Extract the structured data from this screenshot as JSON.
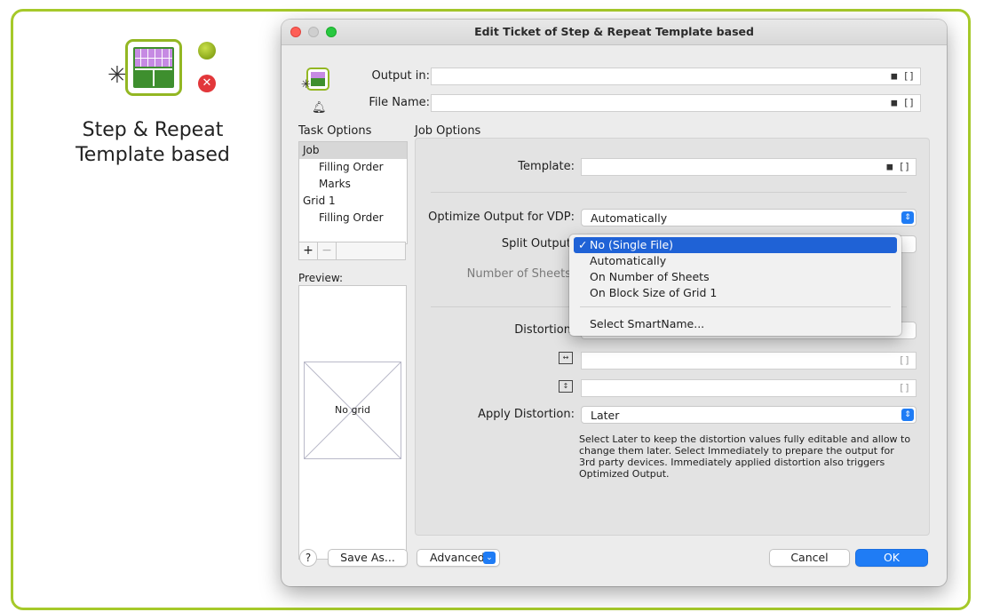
{
  "node": {
    "title_line1": "Step & Repeat",
    "title_line2": "Template based",
    "status_ok_icon": "green-status-dot",
    "status_error_icon": "red-error-x",
    "error_glyph": "✕"
  },
  "window": {
    "title": "Edit Ticket of Step & Repeat Template based"
  },
  "header": {
    "output_in_label": "Output in:",
    "output_in_value": "",
    "file_name_label": "File Name:",
    "file_name_value": "",
    "folder_icon_glyph": "■",
    "bracket_glyph": "[]"
  },
  "task_options": {
    "label": "Task Options",
    "items": [
      {
        "label": "Job",
        "selected": true,
        "indent": false
      },
      {
        "label": "Filling Order",
        "selected": false,
        "indent": true
      },
      {
        "label": "Marks",
        "selected": false,
        "indent": true
      },
      {
        "label": "Grid 1",
        "selected": false,
        "indent": false
      },
      {
        "label": "Filling Order",
        "selected": false,
        "indent": true
      }
    ],
    "add_glyph": "+",
    "remove_glyph": "−"
  },
  "preview": {
    "label": "Preview:",
    "placeholder": "No grid"
  },
  "job_options": {
    "label": "Job Options",
    "template_label": "Template:",
    "template_value": "",
    "optimize_label": "Optimize Output for VDP:",
    "optimize_value": "Automatically",
    "split_label": "Split Output",
    "sheets_label": "Number of Sheets",
    "distortion_label": "Distortion",
    "distortion_h_value": "",
    "distortion_v_value": "",
    "apply_label": "Apply Distortion:",
    "apply_value": "Later",
    "help_text": "Select Later to keep the distortion values fully editable and allow to change them later. Select Immediately to prepare the output for 3rd party devices. Immediately applied distortion also triggers Optimized Output."
  },
  "split_menu": {
    "check_glyph": "✓",
    "items": [
      {
        "label": "No (Single File)",
        "selected": true
      },
      {
        "label": "Automatically",
        "selected": false
      },
      {
        "label": "On Number of Sheets",
        "selected": false
      },
      {
        "label": "On Block Size of Grid 1",
        "selected": false
      }
    ],
    "smartname": "Select SmartName..."
  },
  "footer": {
    "help_label": "?",
    "save_as_label": "Save As...",
    "advanced_label": "Advanced",
    "cancel_label": "Cancel",
    "ok_label": "OK"
  },
  "colors": {
    "frame_green": "#a6c92a",
    "accent_blue": "#1f7cf5",
    "menu_selection": "#1f62d6",
    "error_red": "#e2373a"
  }
}
